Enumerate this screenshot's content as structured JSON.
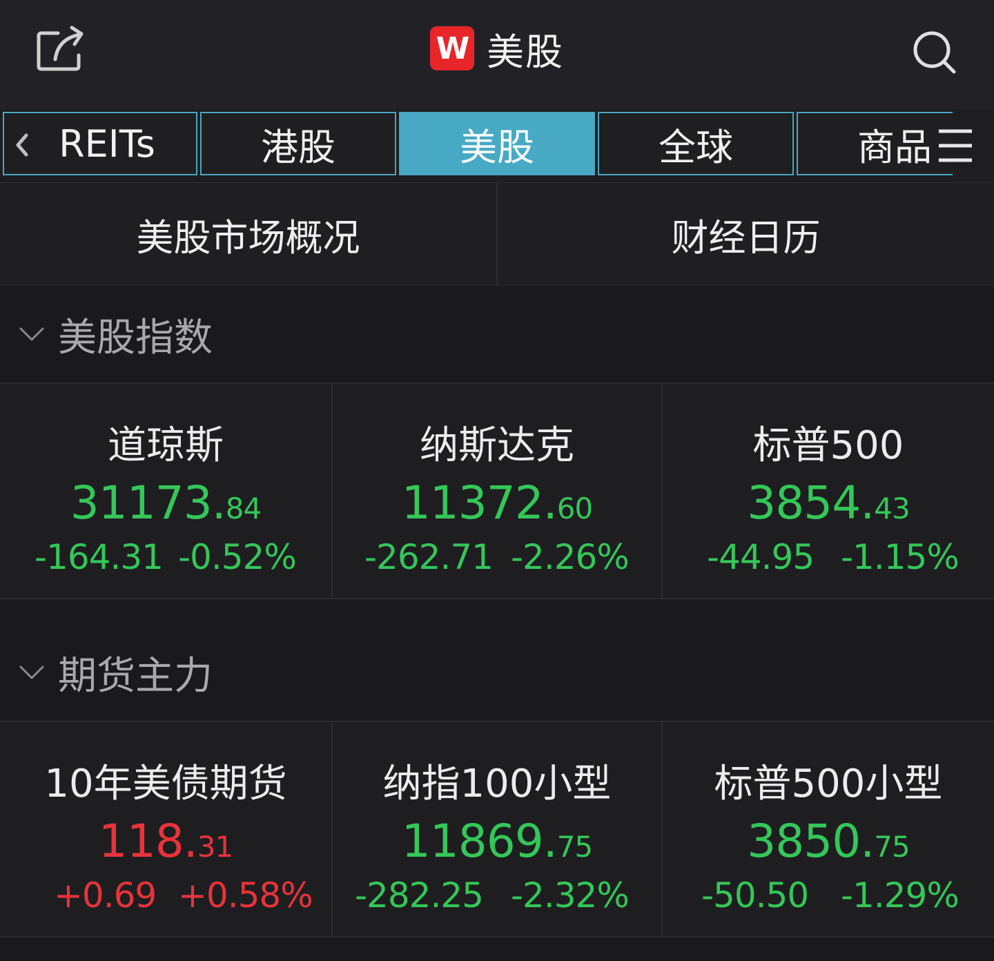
{
  "header": {
    "logo_text": "W",
    "title": "美股",
    "share_icon": "share-icon",
    "search_icon": "search-icon"
  },
  "tabs": [
    {
      "label": "REITs",
      "active": false
    },
    {
      "label": "港股",
      "active": false
    },
    {
      "label": "美股",
      "active": true
    },
    {
      "label": "全球",
      "active": false
    },
    {
      "label": "商品",
      "active": false
    }
  ],
  "overview": {
    "left_label": "美股市场概况",
    "right_label": "财经日历"
  },
  "sections": [
    {
      "title": "美股指数",
      "items": [
        {
          "name": "道琼斯",
          "price_int": "31173.",
          "price_dec": "84",
          "change": "-164.31",
          "pct": "-0.52%",
          "trend": "down"
        },
        {
          "name": "纳斯达克",
          "price_int": "11372.",
          "price_dec": "60",
          "change": "-262.71",
          "pct": "-2.26%",
          "trend": "down"
        },
        {
          "name": "标普500",
          "price_int": "3854.",
          "price_dec": "43",
          "change": "-44.95",
          "pct": "-1.15%",
          "trend": "down"
        }
      ]
    },
    {
      "title": "期货主力",
      "items": [
        {
          "name": "10年美债期货",
          "price_int": "118.",
          "price_dec": "31",
          "change": "+0.69",
          "pct": "+0.58%",
          "trend": "up"
        },
        {
          "name": "纳指100小型",
          "price_int": "11869.",
          "price_dec": "75",
          "change": "-282.25",
          "pct": "-2.32%",
          "trend": "down"
        },
        {
          "name": "标普500小型",
          "price_int": "3850.",
          "price_dec": "75",
          "change": "-50.50",
          "pct": "-1.29%",
          "trend": "down"
        }
      ]
    }
  ],
  "colors": {
    "up": "#e8333a",
    "down": "#34c759",
    "accent": "#48a9c4",
    "logo_red": "#e8262a"
  }
}
